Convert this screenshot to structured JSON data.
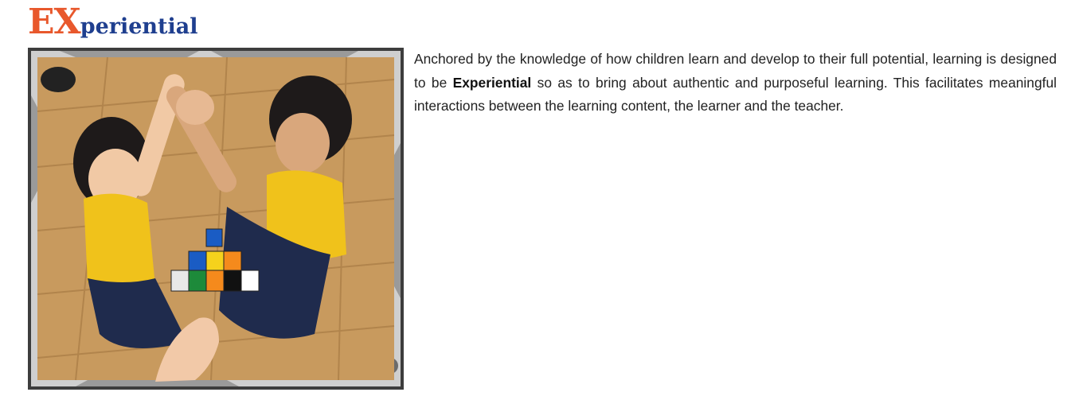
{
  "heading": {
    "accent_text": "EX",
    "rest_text": "periential",
    "accent_color": "#e8582c",
    "rest_color": "#1f3f8f"
  },
  "photo": {
    "frame_icon": "gear-frame-icon",
    "scene": "children-building-cubes-photo"
  },
  "description": {
    "before_bold": "Anchored by the knowledge of how children learn and develop to their full potential, learning is designed to be ",
    "bold": "Experiential",
    "after_bold": " so as to bring about authentic and purposeful learning.  This facilitates meaningful interactions between the learning content, the learner and the teacher."
  },
  "colors": {
    "frame_dark": "#4a4a4a",
    "frame_light": "#d6d6d6",
    "floor": "#c89a5e",
    "uniform_top": "#f0c21b",
    "uniform_bottom": "#1f2b4d"
  }
}
